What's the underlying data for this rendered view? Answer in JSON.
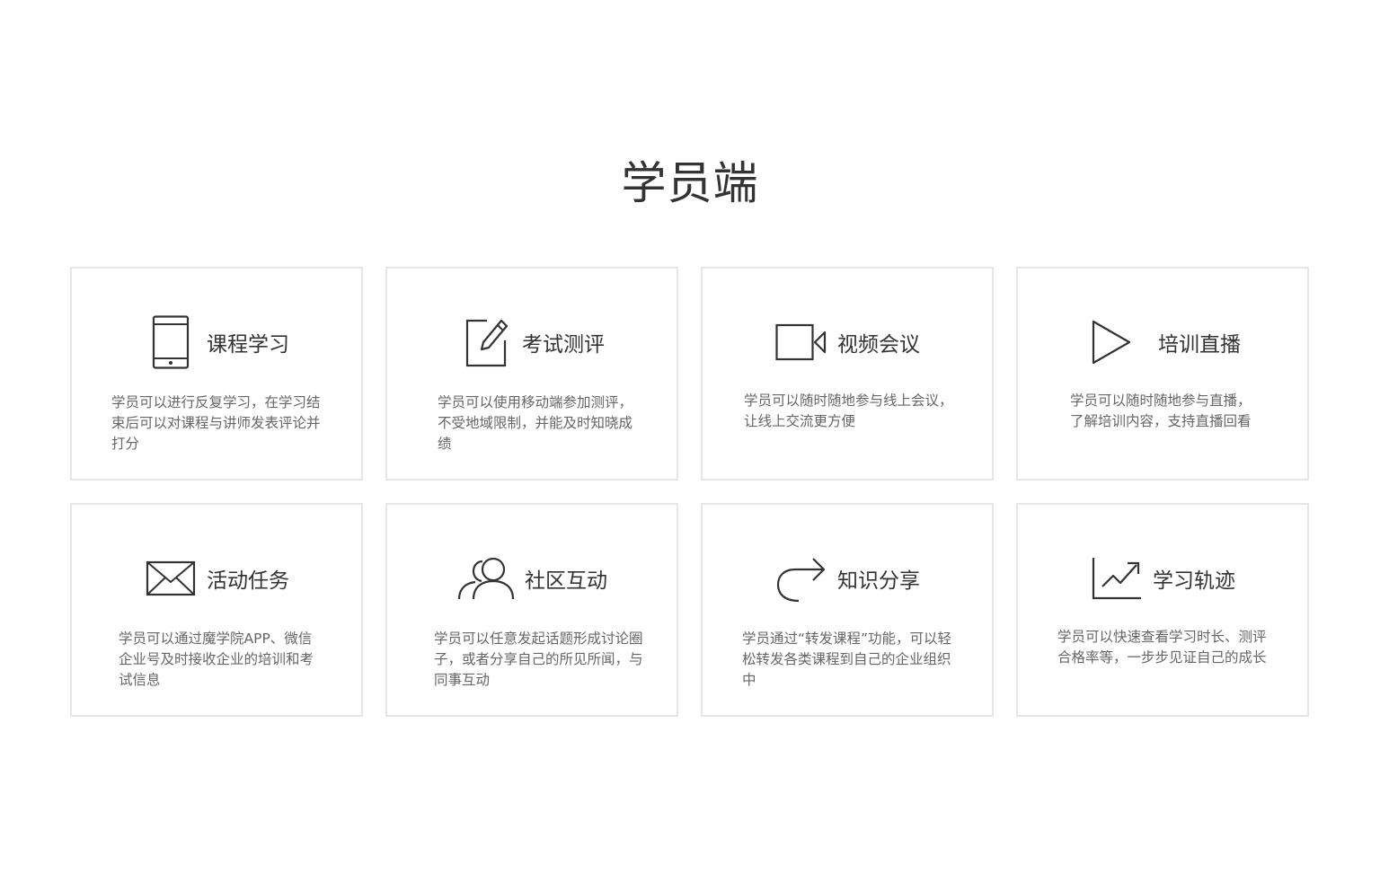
{
  "section": {
    "title": "学员端"
  },
  "cards": [
    {
      "title": "课程学习",
      "icon": "tablet-icon",
      "desc": "学员可以进行反复学习，在学习结束后可以对课程与讲师发表评论并打分"
    },
    {
      "title": "考试测评",
      "icon": "edit-icon",
      "desc": "学员可以使用移动端参加测评，不受地域限制，并能及时知晓成绩"
    },
    {
      "title": "视频会议",
      "icon": "video-camera-icon",
      "desc": "学员可以随时随地参与线上会议，让线上交流更方便"
    },
    {
      "title": "培训直播",
      "icon": "play-icon",
      "desc": "学员可以随时随地参与直播，了解培训内容，支持直播回看"
    },
    {
      "title": "活动任务",
      "icon": "envelope-icon",
      "desc": "学员可以通过魔学院APP、微信企业号及时接收企业的培训和考试信息"
    },
    {
      "title": "社区互动",
      "icon": "users-icon",
      "desc": "学员可以任意发起话题形成讨论圈子，或者分享自己的所见所闻，与同事互动"
    },
    {
      "title": "知识分享",
      "icon": "share-arrow-icon",
      "desc": "学员通过“转发课程”功能，可以轻松转发各类课程到自己的企业组织中"
    },
    {
      "title": "学习轨迹",
      "icon": "trend-chart-icon",
      "desc": "学员可以快速查看学习时长、测评合格率等，一步步见证自己的成长"
    }
  ]
}
